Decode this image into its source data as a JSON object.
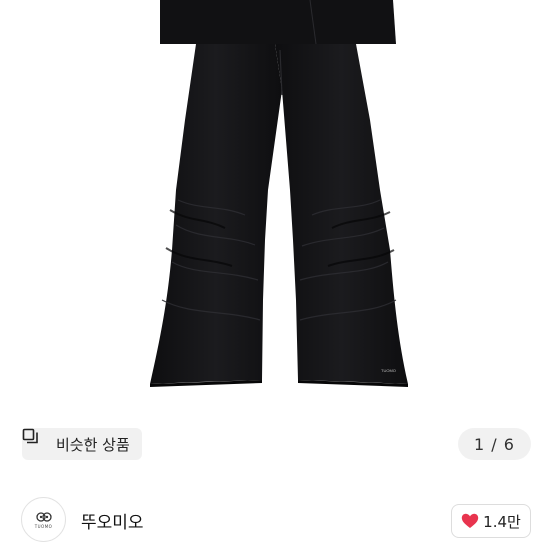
{
  "product_image": {
    "brand_tag": "TUOMO",
    "garment_color": "#141416"
  },
  "similar_button": {
    "label": "비슷한 상품",
    "icon": "similar-items-icon"
  },
  "image_counter": {
    "current": "1",
    "separator": "/",
    "total": "6",
    "text": "1 / 6"
  },
  "seller": {
    "name": "뚜오미오",
    "avatar_logo_text": "TUOMO"
  },
  "like_button": {
    "count": "1.4만",
    "icon": "heart-icon",
    "heart_color": "#e8344e"
  }
}
